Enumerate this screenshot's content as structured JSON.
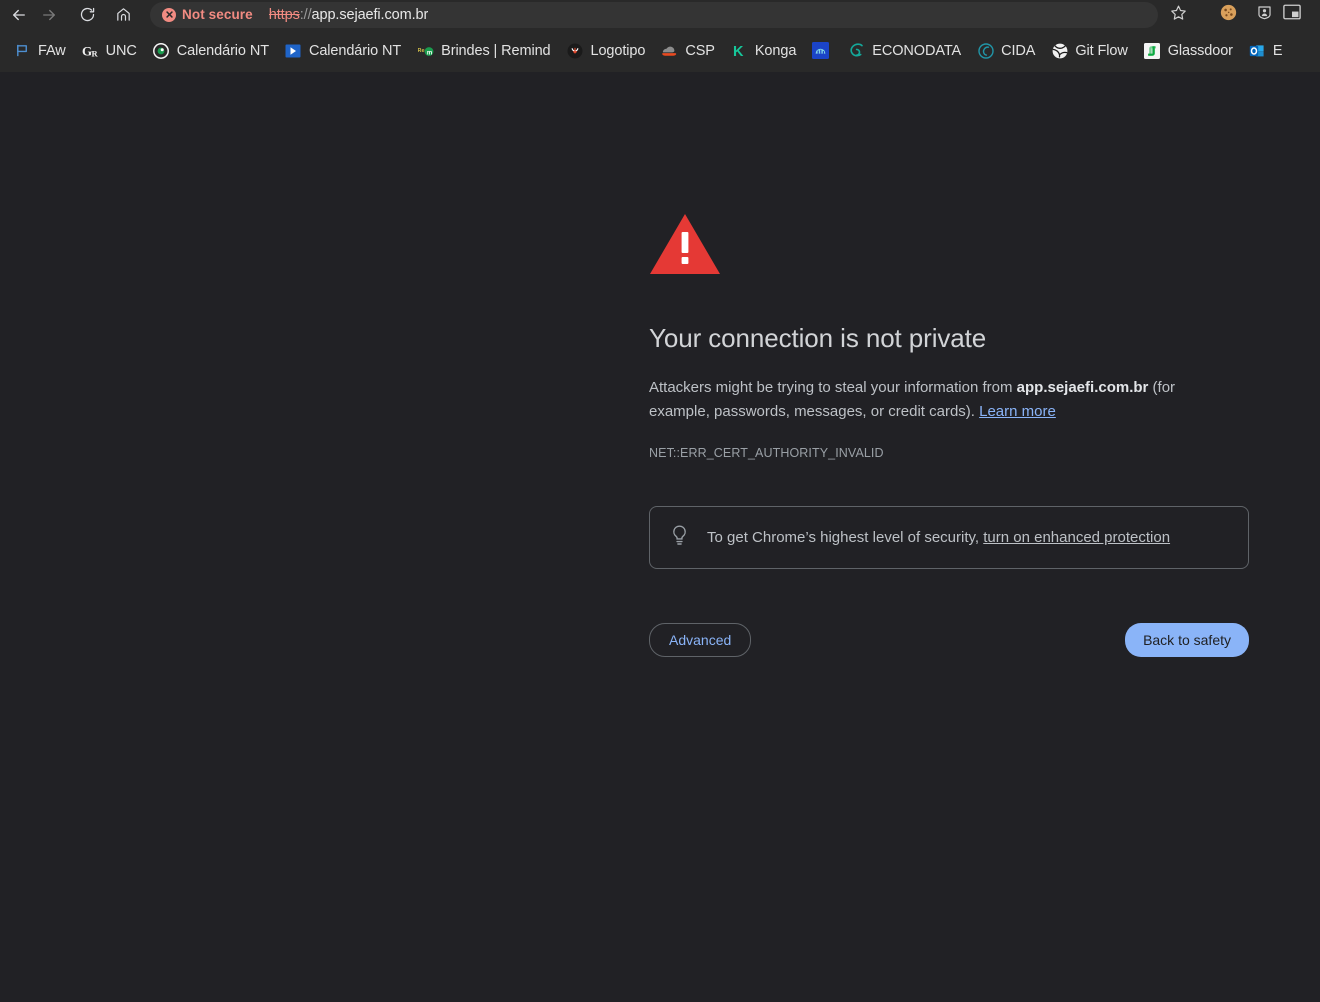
{
  "browser": {
    "nav": {
      "back_icon": "back-arrow-icon",
      "forward_icon": "forward-arrow-icon",
      "reload_icon": "reload-icon",
      "home_icon": "home-icon"
    },
    "omnibox": {
      "security_badge": "Not secure",
      "security_icon": "not-secure-circle-x-icon",
      "url_scheme": "https",
      "url_separator": "://",
      "url_host": "app.sejaefi.com.br",
      "full_url": "https://app.sejaefi.com.br"
    },
    "actions": [
      {
        "name": "bookmark-star-icon",
        "label": "star-icon"
      },
      {
        "name": "cookie-extension-icon",
        "label": "cookie-icon"
      },
      {
        "name": "extension-icon",
        "label": "puzzle-person-icon"
      },
      {
        "name": "picture-in-picture-icon",
        "label": "pip-icon"
      }
    ]
  },
  "bookmarks": [
    {
      "label": "FAw",
      "icon": "faw-flag-icon"
    },
    {
      "label": "UNC",
      "icon": "grammarly-icon"
    },
    {
      "label": "Calendário NT",
      "icon": "calendar-circle-icon"
    },
    {
      "label": "Calendário NT",
      "icon": "blue-play-icon"
    },
    {
      "label": "Brindes | Remind",
      "icon": "remind-icon"
    },
    {
      "label": "Logotipo",
      "icon": "logotipo-icon"
    },
    {
      "label": "CSP",
      "icon": "csp-cloud-icon"
    },
    {
      "label": "Konga",
      "icon": "konga-k-icon"
    },
    {
      "label": "",
      "icon": "blue-square-icon"
    },
    {
      "label": "ECONODATA",
      "icon": "econodata-icon"
    },
    {
      "label": "CIDA",
      "icon": "cida-icon"
    },
    {
      "label": "Git Flow",
      "icon": "git-flow-globe-icon"
    },
    {
      "label": "Glassdoor",
      "icon": "glassdoor-icon"
    },
    {
      "label": "E",
      "icon": "outlook-icon"
    }
  ],
  "interstitial": {
    "warning_icon": "red-warning-triangle-icon",
    "title": "Your connection is not private",
    "body_part1": "Attackers might be trying to steal your information from ",
    "body_host": "app.sejaefi.com.br",
    "body_part2": " (for example, passwords, messages, or credit cards). ",
    "learn_more": "Learn more",
    "error_code": "NET::ERR_CERT_AUTHORITY_INVALID",
    "enhanced_icon": "lightbulb-icon",
    "enhanced_text": "To get Chrome’s highest level of security, ",
    "enhanced_link": "turn on enhanced protection",
    "advanced_button": "Advanced",
    "back_to_safety_button": "Back to safety"
  },
  "colors": {
    "page_background": "#212125",
    "chrome_background": "#292929",
    "omnibox_background": "#343434",
    "danger": "#f28b82",
    "accent_blue": "#8ab4f8",
    "warning_red": "#e53935",
    "body_text": "#bdc1c6"
  }
}
